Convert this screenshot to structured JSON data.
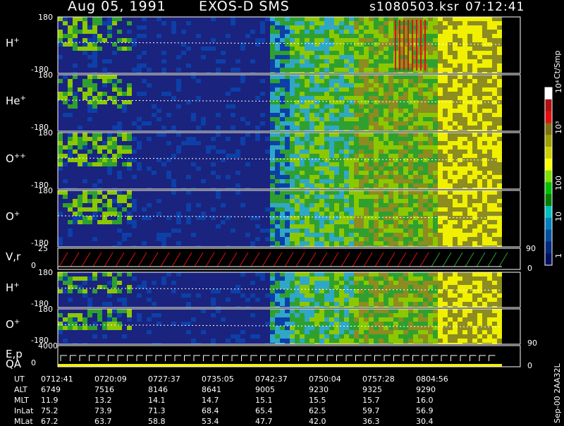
{
  "header": {
    "date": "Aug 05, 1991",
    "instrument": "EXOS-D SMS",
    "file": "s1080503.ksr",
    "time": "07:12:41"
  },
  "chart_data": {
    "type": "heatmap",
    "panels": [
      {
        "name": "H",
        "charge": "+",
        "ymax": "180",
        "ymin": "-180"
      },
      {
        "name": "He",
        "charge": "+",
        "ymax": "180",
        "ymin": "-180"
      },
      {
        "name": "O",
        "charge": "++",
        "ymax": "180",
        "ymin": "-180"
      },
      {
        "name": "O",
        "charge": "+",
        "ymax": "180",
        "ymin": "-180"
      },
      {
        "name": "V,r",
        "charge": "",
        "ymax": "25",
        "ymin": "0",
        "right_top": "90",
        "right_bot": "0"
      },
      {
        "name": "H",
        "charge": "+",
        "ymax": "180",
        "ymin": "-180"
      },
      {
        "name": "O",
        "charge": "+",
        "ymax": "180",
        "ymin": "-180",
        "right_bot": "90"
      },
      {
        "name": "E,p",
        "name2": "QA",
        "charge": "",
        "ymax": "4000",
        "ymin": "0",
        "right_bot": "0"
      }
    ],
    "colorbar": {
      "unit": "Ct/Smp",
      "ticks": [
        "10⁴",
        "10³",
        "100",
        "10",
        "1"
      ],
      "colors": [
        "#ffffff",
        "#b01010",
        "#e01010",
        "#807010",
        "#a0a000",
        "#d0d000",
        "#ffff00",
        "#80e000",
        "#00c000",
        "#008000",
        "#00c0c0",
        "#0080c0",
        "#0050a0",
        "#002880",
        "#001060"
      ]
    },
    "time_axis": {
      "labels": [
        "UT",
        "ALT",
        "MLT",
        "InLat",
        "MLat"
      ],
      "columns": [
        {
          "UT": "0712:41",
          "ALT": "6749",
          "MLT": "11.9",
          "InLat": "75.2",
          "MLat": "67.2"
        },
        {
          "UT": "0720:09",
          "ALT": "7516",
          "MLT": "13.2",
          "InLat": "73.9",
          "MLat": "63.7"
        },
        {
          "UT": "0727:37",
          "ALT": "8146",
          "MLT": "14.1",
          "InLat": "71.3",
          "MLat": "58.8"
        },
        {
          "UT": "0735:05",
          "ALT": "8641",
          "MLT": "14.7",
          "InLat": "68.4",
          "MLat": "53.4"
        },
        {
          "UT": "0742:37",
          "ALT": "9005",
          "MLT": "15.1",
          "InLat": "65.4",
          "MLat": "47.7"
        },
        {
          "UT": "0750:04",
          "ALT": "9230",
          "MLT": "15.5",
          "InLat": "62.5",
          "MLat": "42.0"
        },
        {
          "UT": "0757:28",
          "ALT": "9325",
          "MLT": "15.7",
          "InLat": "59.7",
          "MLat": "36.3"
        },
        {
          "UT": "0804:56",
          "ALT": "9290",
          "MLT": "16.0",
          "InLat": "56.9",
          "MLat": "30.4"
        }
      ]
    },
    "palette": {
      "navy": "#1a237e",
      "blue": "#0d3fa8",
      "cyan": "#2fa8c8",
      "green": "#2fa02f",
      "lime": "#8cc800",
      "olive": "#8c8c20",
      "yellow": "#f0f000",
      "red": "#e01010"
    }
  },
  "footer": {
    "side_label": "Sep-00  2AA32L"
  }
}
